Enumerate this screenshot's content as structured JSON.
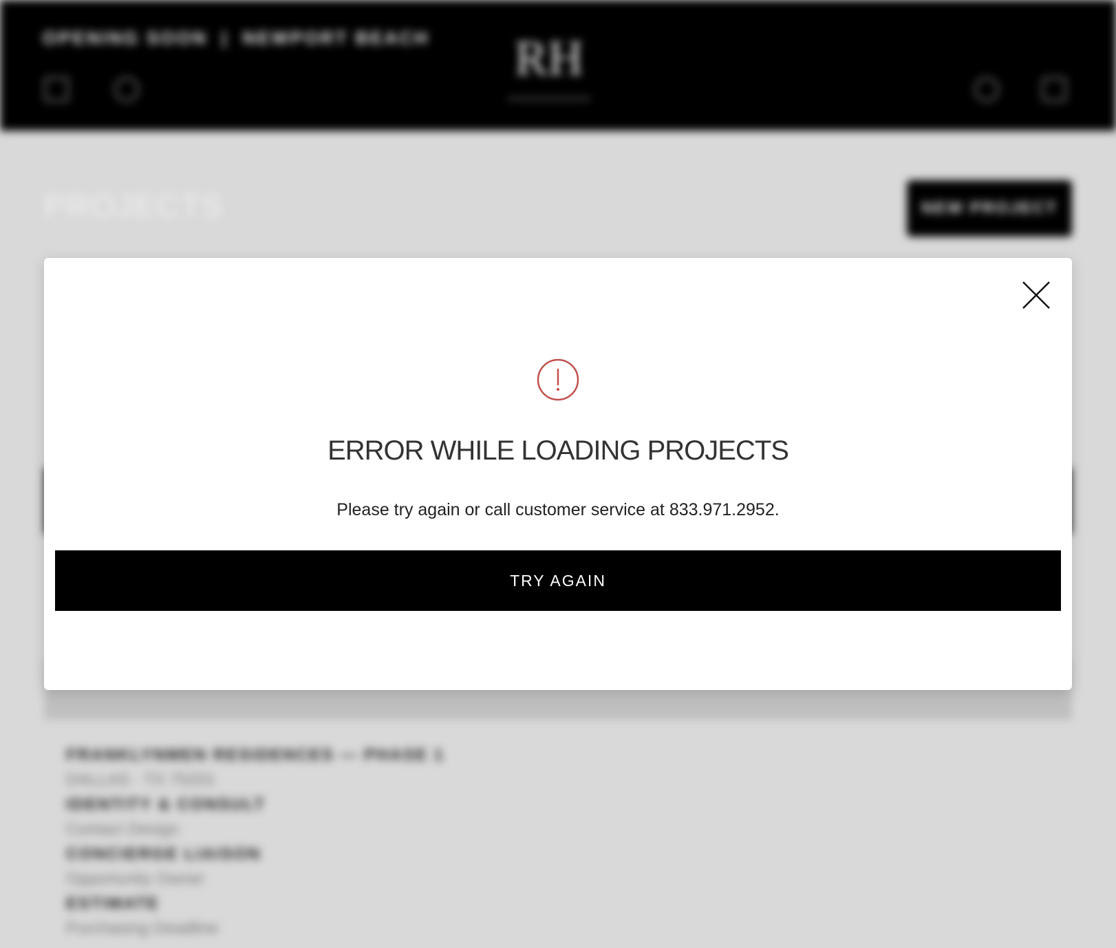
{
  "header": {
    "location": "OPENING SOON",
    "location_secondary": "NEWPORT BEACH",
    "logo_text": "RH"
  },
  "page": {
    "title": "PROJECTS",
    "new_project_label": "NEW PROJECT"
  },
  "modal": {
    "title": "ERROR WHILE LOADING PROJECTS",
    "message": "Please try again or call customer service at 833.971.2952.",
    "button_label": "TRY AGAIN",
    "accent_color": "#c0504d"
  },
  "background_details": {
    "project_name": "FRANKLYNMEN RESIDENCES — PHASE 1",
    "project_meta": "DALLAS · TX 75201",
    "line1": "IDENTITY & CONSULT",
    "line1_sub": "Contact Design",
    "line2": "CONCIERGE LIAISON",
    "line2_sub": "Opportunity Owner",
    "line3": "ESTIMATE",
    "line3_sub": "Purchasing Deadline"
  }
}
